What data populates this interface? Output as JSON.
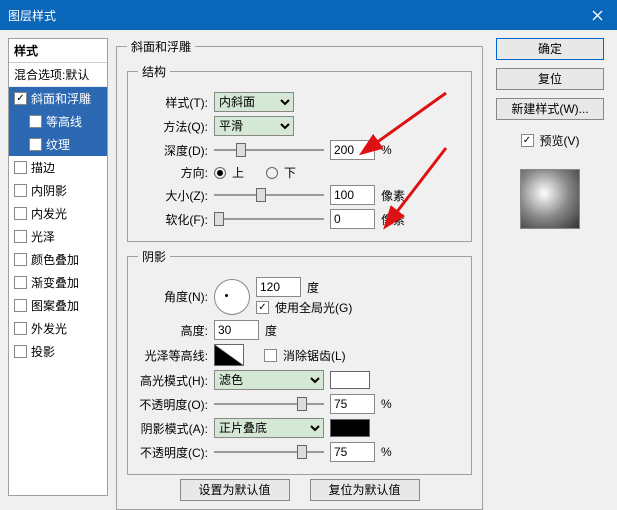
{
  "title": "图层样式",
  "styles": {
    "header": "样式",
    "blending": "混合选项:默认",
    "items": [
      {
        "label": "斜面和浮雕",
        "checked": true,
        "selected": true,
        "sub": false
      },
      {
        "label": "等高线",
        "checked": false,
        "selected": true,
        "sub": true
      },
      {
        "label": "纹理",
        "checked": false,
        "selected": true,
        "sub": true
      },
      {
        "label": "描边",
        "checked": false,
        "selected": false,
        "sub": false
      },
      {
        "label": "内阴影",
        "checked": false,
        "selected": false,
        "sub": false
      },
      {
        "label": "内发光",
        "checked": false,
        "selected": false,
        "sub": false
      },
      {
        "label": "光泽",
        "checked": false,
        "selected": false,
        "sub": false
      },
      {
        "label": "颜色叠加",
        "checked": false,
        "selected": false,
        "sub": false
      },
      {
        "label": "渐变叠加",
        "checked": false,
        "selected": false,
        "sub": false
      },
      {
        "label": "图案叠加",
        "checked": false,
        "selected": false,
        "sub": false
      },
      {
        "label": "外发光",
        "checked": false,
        "selected": false,
        "sub": false
      },
      {
        "label": "投影",
        "checked": false,
        "selected": false,
        "sub": false
      }
    ]
  },
  "bevel": {
    "group": "斜面和浮雕",
    "structure": "结构",
    "style_lbl": "样式(T):",
    "style_val": "内斜面",
    "tech_lbl": "方法(Q):",
    "tech_val": "平滑",
    "depth_lbl": "深度(D):",
    "depth_val": "200",
    "depth_unit": "%",
    "dir_lbl": "方向:",
    "dir_up": "上",
    "dir_down": "下",
    "size_lbl": "大小(Z):",
    "size_val": "100",
    "size_unit": "像素",
    "soft_lbl": "软化(F):",
    "soft_val": "0",
    "soft_unit": "像素"
  },
  "shade": {
    "group": "阴影",
    "angle_lbl": "角度(N):",
    "angle_val": "120",
    "angle_unit": "度",
    "global": "使用全局光(G)",
    "alt_lbl": "高度:",
    "alt_val": "30",
    "alt_unit": "度",
    "gloss_lbl": "光泽等高线:",
    "anti": "消除锯齿(L)",
    "hl_mode_lbl": "高光模式(H):",
    "hl_mode_val": "滤色",
    "hl_op_lbl": "不透明度(O):",
    "hl_op_val": "75",
    "pct": "%",
    "sh_mode_lbl": "阴影模式(A):",
    "sh_mode_val": "正片叠底",
    "sh_op_lbl": "不透明度(C):",
    "sh_op_val": "75"
  },
  "buttons": {
    "defaults": "设置为默认值",
    "reset": "复位为默认值",
    "ok": "确定",
    "cancel": "复位",
    "newstyle": "新建样式(W)...",
    "preview": "预览(V)"
  }
}
